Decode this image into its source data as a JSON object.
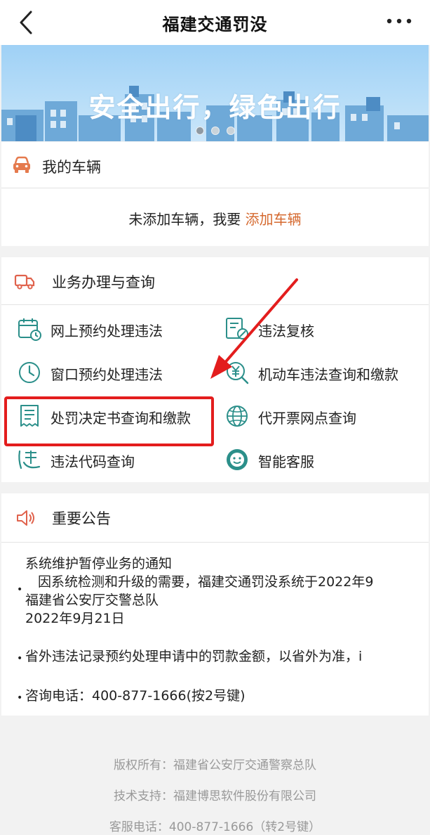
{
  "nav": {
    "title": "福建交通罚没"
  },
  "banner": {
    "text": "安全出行，绿色出行"
  },
  "vehicles": {
    "header": "我的车辆",
    "empty_text": "未添加车辆，我要",
    "add_link": "添加车辆"
  },
  "business": {
    "header": "业务办理与查询",
    "items": [
      {
        "label": "网上预约处理违法",
        "icon": "calendar-icon"
      },
      {
        "label": "违法复核",
        "icon": "review-document-icon"
      },
      {
        "label": "窗口预约处理违法",
        "icon": "clock-icon"
      },
      {
        "label": "机动车违法查询和缴款",
        "icon": "yuan-search-icon"
      },
      {
        "label": "处罚决定书查询和缴款",
        "icon": "receipt-icon"
      },
      {
        "label": "代开票网点查询",
        "icon": "globe-icon"
      },
      {
        "label": "违法代码查询",
        "icon": "violation-code-icon"
      },
      {
        "label": "智能客服",
        "icon": "customer-service-icon"
      }
    ]
  },
  "notice": {
    "header": "重要公告",
    "lines": [
      "系统维护暂停业务的通知",
      "因系统检测和升级的需要，福建交通罚没系统于2022年9",
      "福建省公安厅交警总队",
      "2022年9月21日",
      "省外违法记录预约处理申请中的罚款金额，以省外为准，i",
      "咨询电话：400-877-1666(按2号键)"
    ]
  },
  "footer": {
    "copyright": "版权所有：福建省公安厅交通警察总队",
    "support": "技术支持：福建博思软件股份有限公司",
    "hotline": "客服电话：400-877-1666（转2号键）"
  },
  "colors": {
    "accent": "#d5692f",
    "highlight": "#e31d1d",
    "icon": "#2b8f8a"
  }
}
